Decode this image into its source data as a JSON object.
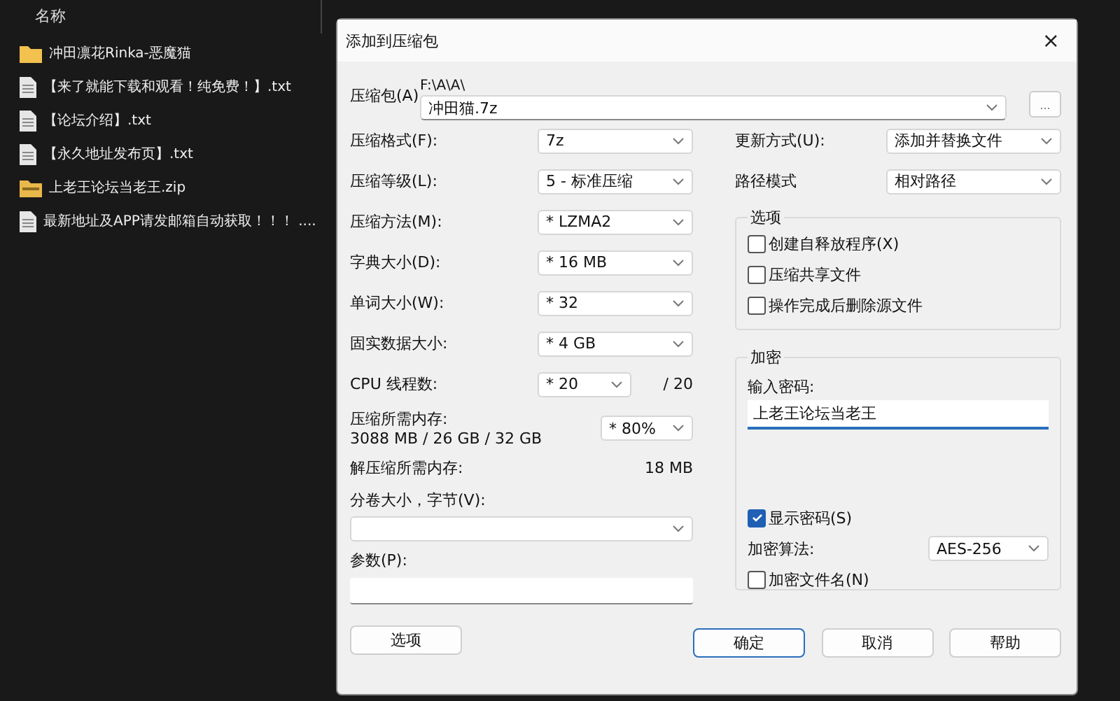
{
  "explorer": {
    "columns": [
      {
        "label": "名称"
      }
    ],
    "files": [
      {
        "name": "冲田凛花Rinka-恶魔猫",
        "kind": "folder"
      },
      {
        "name": "【来了就能下载和观看！纯免费！】.txt",
        "kind": "text"
      },
      {
        "name": "【论坛介绍】.txt",
        "kind": "text"
      },
      {
        "name": "【永久地址发布页】.txt",
        "kind": "text"
      },
      {
        "name": "上老王论坛当老王.zip",
        "kind": "zip"
      },
      {
        "name": "最新地址及APP请发邮箱自动获取！！！ ....",
        "kind": "text"
      }
    ]
  },
  "dialog": {
    "title": "添加到压缩包",
    "close": "×",
    "archive": {
      "label": "压缩包(A)",
      "path": "F:\\A\\A\\",
      "value": "冲田猫.7z",
      "browse": "..."
    },
    "settings": [
      {
        "label": "压缩格式(F):",
        "value": "7z"
      },
      {
        "label": "压缩等级(L):",
        "value": "5 - 标准压缩"
      },
      {
        "label": "压缩方法(M):",
        "value": "*  LZMA2"
      },
      {
        "label": "字典大小(D):",
        "value": "*  16 MB"
      },
      {
        "label": "单词大小(W):",
        "value": "*  32"
      },
      {
        "label": "固实数据大小:",
        "value": "*  4 GB"
      }
    ],
    "cpu": {
      "label": "CPU 线程数:",
      "value": "*  20",
      "max": "/ 20"
    },
    "memory": {
      "label": "压缩所需内存:",
      "detail": "3088 MB / 26 GB / 32 GB",
      "value": "* 80%"
    },
    "decompress": {
      "label": "解压缩所需内存:",
      "value": "18 MB"
    },
    "volume": {
      "label": "分卷大小，字节(V):"
    },
    "params": {
      "label": "参数(P):"
    },
    "options_button": "选项",
    "update": {
      "label": "更新方式(U):",
      "value": "添加并替换文件"
    },
    "path_mode": {
      "label": "路径模式",
      "value": "相对路径"
    },
    "options_group": {
      "title": "选项",
      "items": [
        {
          "label": "创建自释放程序(X)",
          "checked": false
        },
        {
          "label": "压缩共享文件",
          "checked": false
        },
        {
          "label": "操作完成后删除源文件",
          "checked": false
        }
      ]
    },
    "encryption": {
      "title": "加密",
      "password_label": "输入密码:",
      "password": "上老王论坛当老王",
      "show_password": {
        "label": "显示密码(S)",
        "checked": true
      },
      "method": {
        "label": "加密算法:",
        "value": "AES-256"
      },
      "encrypt_names": {
        "label": "加密文件名(N)",
        "checked": false
      }
    },
    "buttons": [
      {
        "label": "确定",
        "focused": true
      },
      {
        "label": "取消",
        "focused": false
      },
      {
        "label": "帮助",
        "focused": false
      }
    ]
  }
}
